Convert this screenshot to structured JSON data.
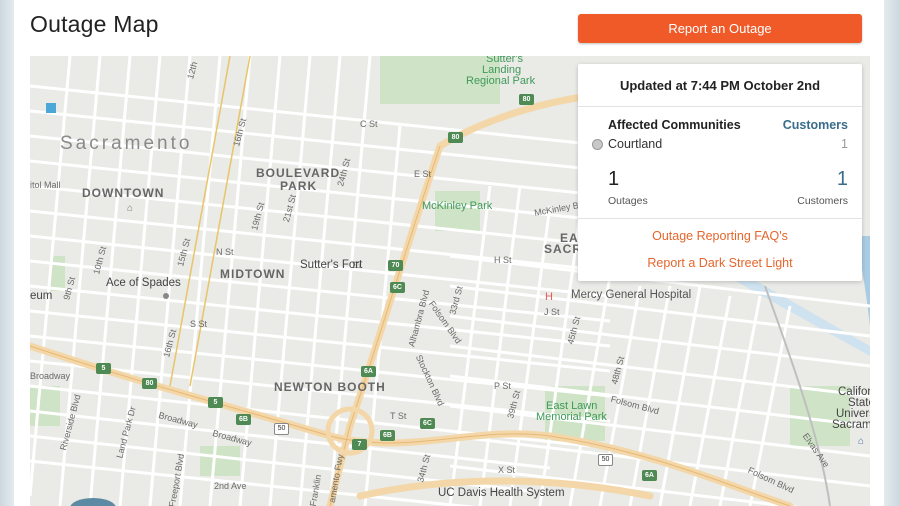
{
  "page": {
    "title": "Outage Map",
    "report_button": "Report an Outage"
  },
  "panel": {
    "updated": "Updated at 7:44 PM October 2nd",
    "affected_header": "Affected Communities",
    "customers_header": "Customers",
    "communities": [
      {
        "name": "Courtland",
        "customers": "1"
      }
    ],
    "outages_value": "1",
    "outages_label": "Outages",
    "customers_value": "1",
    "customers_label": "Customers",
    "faq_link": "Outage Reporting FAQ's",
    "streetlight_link": "Report a Dark Street Light"
  },
  "map": {
    "city": "Sacramento",
    "districts": {
      "downtown": "DOWNTOWN",
      "boulevard": "BOULEVARD",
      "park": "PARK",
      "midtown": "MIDTOWN",
      "newton_booth": "NEWTON BOOTH",
      "east": "EAST",
      "sacrame": "SACRAME"
    },
    "pois": {
      "sutters_landing_1": "Sutter's",
      "sutters_landing_2": "Landing",
      "sutters_landing_3": "Regional Park",
      "mckinley": "McKinley Park",
      "sutters_fort": "Sutter's Fort",
      "ace_of_spades": "Ace of Spades",
      "mercy": "Mercy General Hospital",
      "east_lawn_1": "East Lawn",
      "east_lawn_2": "Memorial Park",
      "uc_davis": "UC Davis Health System",
      "csu_1": "California",
      "csu_2": "State",
      "csu_3": "University,",
      "csu_4": "Sacramento",
      "eum": "eum",
      "itol_mall": "itol Mall",
      "broadway_left": "Broadway"
    },
    "streets": {
      "s12th": "12th",
      "s16th_a": "16th St",
      "s16th_b": "16th St",
      "s15th": "15th St",
      "s19th": "19th St",
      "s21st": "21st St",
      "s24th": "24th St",
      "s10th": "10th St",
      "s9th": "9th St",
      "alhambra": "Alhambra Blvd",
      "folsom_a": "Folsom Blvd",
      "folsom_b": "Folsom Blvd",
      "folsom_c": "Folsom Blvd",
      "stockton": "Stockton Blvd",
      "s33rd": "33rd St",
      "s39th": "39th St",
      "s34th": "34th St",
      "s48th": "48th St",
      "s45th": "45th St",
      "mckinley_blvd": "McKinley Blvd",
      "broadway_a": "Broadway",
      "broadway_b": "Broadway",
      "riverside": "Riverside Blvd",
      "land_park": "Land Park Dr",
      "freeport": "Freeport Blvd",
      "sacramento_fwy": "amento Fwy",
      "elvas": "Elvas Ave",
      "c_st": "C St",
      "e_st": "E St",
      "h_st": "H St",
      "j_st": "J St",
      "n_st": "N St",
      "p_st": "P St",
      "s_st": "S St",
      "t_st": "T St",
      "x_st": "X St",
      "second_ave": "2nd Ave",
      "fruitridge": "Franklin"
    },
    "shields": {
      "r80_top": "80",
      "r80_bottom": "80",
      "r70": "70",
      "r6c": "6C",
      "r6a": "6A",
      "r6b": "6B",
      "r5": "5",
      "r7": "7",
      "r6b2": "6B",
      "r6c2": "6C",
      "r50_a": "50",
      "r50_b": "50",
      "r6a2": "6A",
      "r5b": "5"
    }
  }
}
